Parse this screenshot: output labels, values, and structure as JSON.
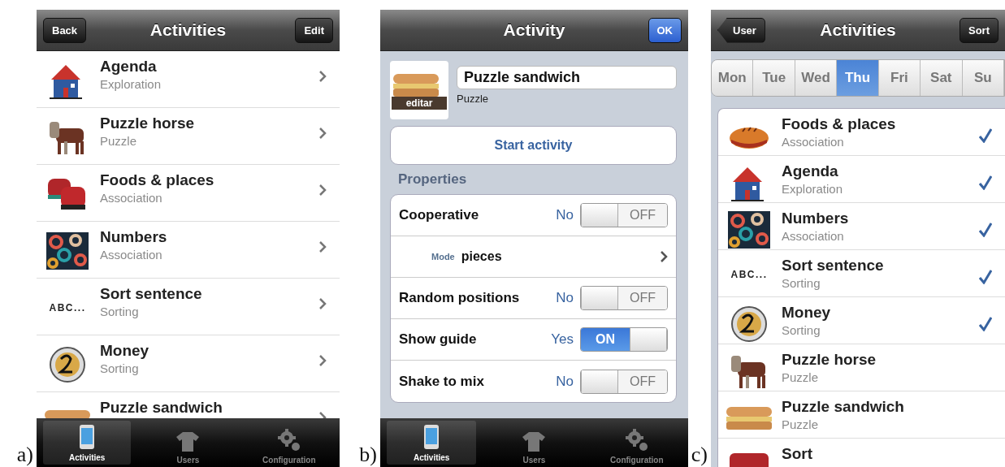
{
  "panels": [
    {
      "label": "a)",
      "kind": "list",
      "nav": {
        "title": "Activities",
        "left": {
          "label": "Back",
          "kind": "plain"
        },
        "right": {
          "label": "Edit",
          "kind": "plain"
        }
      },
      "items": [
        {
          "title": "Agenda",
          "subtitle": "Exploration",
          "kind": "house"
        },
        {
          "title": "Puzzle horse",
          "subtitle": "Puzzle",
          "kind": "horse"
        },
        {
          "title": "Foods & places",
          "subtitle": "Association",
          "kind": "melon"
        },
        {
          "title": "Numbers",
          "subtitle": "Association",
          "kind": "numbers"
        },
        {
          "title": "Sort sentence",
          "subtitle": "Sorting",
          "kind": "text",
          "thumb_text": "ABC..."
        },
        {
          "title": "Money",
          "subtitle": "Sorting",
          "kind": "coin"
        },
        {
          "title": "Puzzle sandwich",
          "kind": "sandwich"
        }
      ],
      "tab_bar": [
        {
          "label": "Activities",
          "selected": true
        },
        {
          "label": "Users",
          "selected": false
        },
        {
          "label": "Configuration",
          "selected": false
        }
      ]
    },
    {
      "label": "b)",
      "kind": "detail",
      "nav": {
        "title": "Activity",
        "right": {
          "label": "OK",
          "kind": "done"
        }
      },
      "activity": {
        "thumb_caption": "editar",
        "name": "Puzzle sandwich",
        "type": "Puzzle"
      },
      "start_button": "Start activity",
      "section": "Properties",
      "properties": [
        {
          "kind": "switch",
          "label": "Cooperative",
          "value": "No",
          "on": false,
          "switch_text": "OFF"
        },
        {
          "kind": "option",
          "caption": "Mode",
          "value": "pieces"
        },
        {
          "kind": "switch",
          "label": "Random positions",
          "value": "No",
          "on": false,
          "switch_text": "OFF"
        },
        {
          "kind": "switch",
          "label": "Show guide",
          "value": "Yes",
          "on": true,
          "switch_text": "ON"
        },
        {
          "kind": "switch",
          "label": "Shake to mix",
          "value": "No",
          "on": false,
          "switch_text": "OFF"
        }
      ],
      "tab_bar": [
        {
          "label": "Activities",
          "selected": true
        },
        {
          "label": "Users",
          "selected": false
        },
        {
          "label": "Configuration",
          "selected": false
        }
      ]
    },
    {
      "label": "c)",
      "kind": "schedule",
      "nav": {
        "title": "Activities",
        "left": {
          "label": "User",
          "kind": "back"
        },
        "right": {
          "label": "Sort",
          "kind": "plain"
        }
      },
      "days": [
        {
          "label": "Mon",
          "selected": false
        },
        {
          "label": "Tue",
          "selected": false
        },
        {
          "label": "Wed",
          "selected": false
        },
        {
          "label": "Thu",
          "selected": true
        },
        {
          "label": "Fri",
          "selected": false
        },
        {
          "label": "Sat",
          "selected": false
        },
        {
          "label": "Su",
          "selected": false
        }
      ],
      "items": [
        {
          "title": "Foods & places",
          "subtitle": "Association",
          "kind": "bread",
          "checked": true
        },
        {
          "title": "Agenda",
          "subtitle": "Exploration",
          "kind": "house",
          "checked": true
        },
        {
          "title": "Numbers",
          "subtitle": "Association",
          "kind": "numbers",
          "checked": true
        },
        {
          "title": "Sort sentence",
          "subtitle": "Sorting",
          "kind": "text",
          "thumb_text": "ABC...",
          "checked": true
        },
        {
          "title": "Money",
          "subtitle": "Sorting",
          "kind": "coin",
          "checked": true
        },
        {
          "title": "Puzzle horse",
          "subtitle": "Puzzle",
          "kind": "horse",
          "checked": false
        },
        {
          "title": "Puzzle sandwich",
          "subtitle": "Puzzle",
          "kind": "sandwich",
          "checked": false
        },
        {
          "title": "Sort",
          "kind": "block",
          "checked": false
        }
      ]
    }
  ]
}
